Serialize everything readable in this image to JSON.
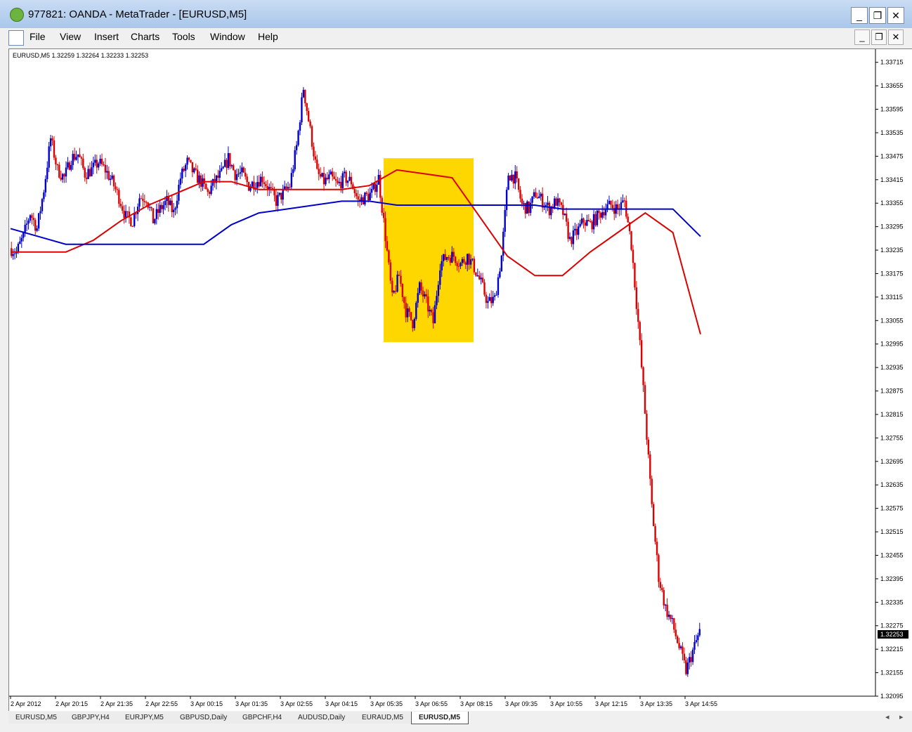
{
  "window": {
    "title": "977821: OANDA - MetaTrader - [EURUSD,M5]"
  },
  "menu": [
    "File",
    "View",
    "Insert",
    "Charts",
    "Tools",
    "Window",
    "Help"
  ],
  "chart_header": "EURUSD,M5  1.32259 1.32264 1.32233 1.32253",
  "chart_data": {
    "type": "candlestick",
    "symbol": "EURUSD",
    "timeframe": "M5",
    "ohlc_current": {
      "open": 1.32259,
      "high": 1.32264,
      "low": 1.32233,
      "close": 1.32253
    },
    "current_price_label": "1.32253",
    "y_ticks": [
      "1.33715",
      "1.33655",
      "1.33595",
      "1.33535",
      "1.33475",
      "1.33415",
      "1.33355",
      "1.33295",
      "1.33235",
      "1.33175",
      "1.33115",
      "1.33055",
      "1.32995",
      "1.32935",
      "1.32875",
      "1.32815",
      "1.32755",
      "1.32695",
      "1.32635",
      "1.32575",
      "1.32515",
      "1.32455",
      "1.32395",
      "1.32335",
      "1.32275",
      "1.32215",
      "1.32155",
      "1.32095"
    ],
    "x_ticks": [
      "2 Apr 2012",
      "2 Apr 20:15",
      "2 Apr 21:35",
      "2 Apr 22:55",
      "3 Apr 00:15",
      "3 Apr 01:35",
      "3 Apr 02:55",
      "3 Apr 04:15",
      "3 Apr 05:35",
      "3 Apr 06:55",
      "3 Apr 08:15",
      "3 Apr 09:35",
      "3 Apr 10:55",
      "3 Apr 12:15",
      "3 Apr 13:35",
      "3 Apr 14:55"
    ],
    "ylim": [
      1.32095,
      1.33745
    ],
    "bull_color": "#0000cc",
    "bear_color": "#dd0000",
    "highlight_color": "#ffd700",
    "highlight_zone": {
      "from": 1.33,
      "to": 1.3347
    },
    "moving_averages": [
      {
        "color": "#dd0000",
        "values": [
          1.3323,
          1.3323,
          1.3323,
          1.3326,
          1.3331,
          1.3335,
          1.3338,
          1.3341,
          1.3341,
          1.3339,
          1.3339,
          1.3339,
          1.3339,
          1.334,
          1.3344,
          1.3343,
          1.3342,
          1.3332,
          1.3322,
          1.3317,
          1.3317,
          1.3323,
          1.3328,
          1.3333,
          1.3328,
          1.3302
        ]
      },
      {
        "color": "#0000cc",
        "values": [
          1.3329,
          1.3327,
          1.3325,
          1.3325,
          1.3325,
          1.3325,
          1.3325,
          1.3325,
          1.333,
          1.3333,
          1.3334,
          1.3335,
          1.3336,
          1.3336,
          1.3335,
          1.3335,
          1.3335,
          1.3335,
          1.3335,
          1.3335,
          1.3334,
          1.3334,
          1.3334,
          1.3334,
          1.3334,
          1.3327
        ]
      }
    ],
    "path": [
      1.3324,
      1.3323,
      1.3327,
      1.3333,
      1.3329,
      1.3339,
      1.3352,
      1.3344,
      1.3342,
      1.3347,
      1.3348,
      1.3343,
      1.3344,
      1.3346,
      1.3344,
      1.3341,
      1.3337,
      1.3332,
      1.3331,
      1.3337,
      1.3337,
      1.3331,
      1.3334,
      1.3336,
      1.3333,
      1.3342,
      1.3346,
      1.3343,
      1.3341,
      1.3338,
      1.3341,
      1.3343,
      1.3347,
      1.3343,
      1.3343,
      1.334,
      1.3341,
      1.3342,
      1.3339,
      1.3336,
      1.3338,
      1.334,
      1.335,
      1.3365,
      1.3354,
      1.3343,
      1.3341,
      1.3342,
      1.334,
      1.3342,
      1.3341,
      1.3336,
      1.3337,
      1.3338,
      1.3342,
      1.3327,
      1.3311,
      1.3317,
      1.3308,
      1.3305,
      1.3314,
      1.331,
      1.3305,
      1.332,
      1.3322,
      1.3322,
      1.332,
      1.3322,
      1.3319,
      1.3315,
      1.331,
      1.3311,
      1.3322,
      1.3343,
      1.3342,
      1.3335,
      1.3334,
      1.3338,
      1.3336,
      1.3334,
      1.3336,
      1.3333,
      1.3326,
      1.3328,
      1.3331,
      1.333,
      1.3332,
      1.3334,
      1.3335,
      1.3334,
      1.3336,
      1.3325,
      1.3305,
      1.3282,
      1.3258,
      1.324,
      1.3232,
      1.3228,
      1.3222,
      1.3216,
      1.3221,
      1.3226
    ]
  },
  "tabs": [
    "EURUSD,M5",
    "GBPJPY,H4",
    "EURJPY,M5",
    "GBPUSD,Daily",
    "GBPCHF,H4",
    "AUDUSD,Daily",
    "EURAUD,M5",
    "EURUSD,M5"
  ],
  "active_tab_index": 7,
  "scroll_arrows": {
    "left": "◂",
    "right": "▸"
  }
}
